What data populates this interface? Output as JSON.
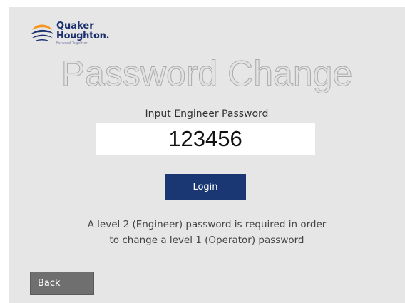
{
  "logo": {
    "line1": "Quaker",
    "line2": "Houghton.",
    "tagline": "Forward Together"
  },
  "page": {
    "title": "Password Change",
    "prompt": "Input Engineer Password"
  },
  "password_field": {
    "value": "123456"
  },
  "login_button": {
    "label": "Login"
  },
  "info": {
    "line1": "A level 2 (Engineer) password is required in order",
    "line2": "to change a level 1 (Operator) password"
  },
  "back_button": {
    "label": "Back"
  },
  "colors": {
    "brand_navy": "#1b2f6e",
    "brand_orange": "#f7941d",
    "login_button_bg": "#1a3773",
    "back_button_bg": "#6f6f6f",
    "panel_bg": "#e6e6e6"
  }
}
